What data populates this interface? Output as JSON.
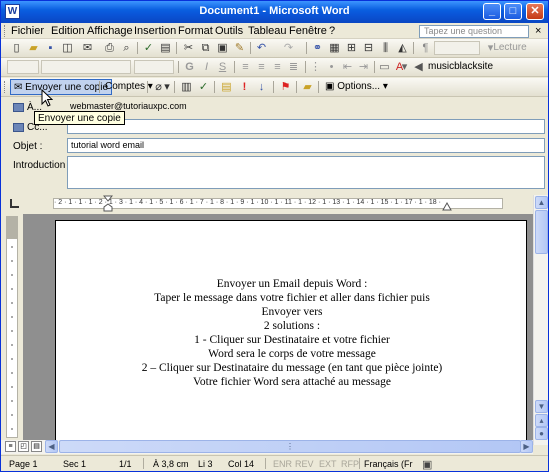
{
  "window": {
    "title": "Document1 - Microsoft Word",
    "app_icon": "W",
    "minimize": "_",
    "maximize": "□",
    "close": "✕"
  },
  "menu": {
    "items": [
      "Fichier",
      "Edition",
      "Affichage",
      "Insertion",
      "Format",
      "Outils",
      "Tableau",
      "Fenêtre",
      "?"
    ],
    "question_placeholder": "Tapez une question",
    "close_doc": "×"
  },
  "toolbar": {
    "read_label": "Lecture",
    "search_site": "musicblacksite"
  },
  "mail_toolbar": {
    "send_copy": "Envoyer une copie",
    "accounts": "Comptes",
    "options": "Options...",
    "tooltip": "Envoyer une copie"
  },
  "header": {
    "to_label": "À...",
    "to_value": "webmaster@tutoriauxpc.com",
    "cc_label": "Cc...",
    "cc_value": "",
    "subject_label": "Objet :",
    "subject_value": "tutorial word email",
    "intro_label": "Introduction :",
    "intro_value": ""
  },
  "ruler": {
    "h_ticks": "· 2 · 1 · 1 · 1 · 2 · 1 · 3 · 1 · 4 · 1 · 5 · 1 · 6 · 1 · 7 · 1 · 8 · 1 · 9 · 1 · 10 · 1 · 11 · 1 · 12 · 1 · 13 · 1 · 14 · 1 · 15 · 1 · 17 · 1 · 18 ·"
  },
  "document": {
    "lines": [
      "Envoyer un Email depuis Word :",
      "Taper le message dans votre fichier et aller dans fichier puis",
      "Envoyer vers",
      "2 solutions :",
      "1 - Cliquer sur Destinataire et votre fichier",
      "Word sera le corps de votre message",
      "2 – Cliquer sur Destinataire du message (en tant que pièce jointe)",
      "Votre fichier Word sera attaché au message"
    ]
  },
  "status": {
    "page": "Page  1",
    "section": "Sec  1",
    "pages": "1/1",
    "at": "À  3,8 cm",
    "line": "Li  3",
    "col": "Col  14",
    "enr": "ENR",
    "rev": "REV",
    "ext": "EXT",
    "rfp": "RFP",
    "language": "Français (Fr"
  }
}
